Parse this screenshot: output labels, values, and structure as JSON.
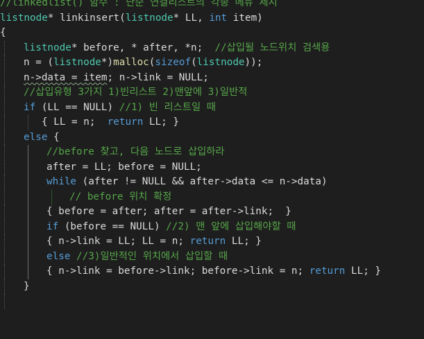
{
  "editor": {
    "theme": {
      "background": "#1e1e1e",
      "comment": "#57a64a",
      "keyword": "#569cd6",
      "function": "#dcdcaa",
      "text": "#dcdcdc"
    },
    "lines": {
      "l0": {
        "text": "//linkedlist() 함수 : 단순 연결리스트의 각종 메뉴 제시"
      },
      "l1": {
        "type": "listnode",
        "rest": "* linkinsert(",
        "ptype": "listnode",
        "rest2": "* LL, ",
        "kw": "int",
        "rest3": " item)"
      },
      "l2": {
        "text": "{"
      },
      "l3": {
        "type": "listnode",
        "rest": "* before, * after, *n;  ",
        "comment": "//삽입될 노드위치 검색용"
      },
      "l4": {
        "a": "n = (",
        "type": "listnode",
        "b": "*)",
        "fn": "malloc",
        "c": "(",
        "kw": "sizeof",
        "d": "(",
        "type2": "listnode",
        "e": "));"
      },
      "l5": {
        "squig": "n->data = item",
        "rest": "; n->link = NULL;"
      },
      "l6": {
        "comment": "//삽입유형 3가지 1)빈리스트 2)맨앞에 3)일반적"
      },
      "l7": {
        "kw": "if",
        "rest": " (LL == NULL) ",
        "comment": "//1) 빈 리스트일 때"
      },
      "l8": {
        "a": "{ LL = n;  ",
        "kw": "return",
        "b": " LL; }"
      },
      "l9": {
        "kw": "else",
        "rest": " {"
      },
      "l10": {
        "comment": "//before 찾고, 다음 노드로 삽입하라"
      },
      "l11": {
        "text": "after = LL; before = NULL;"
      },
      "l12": {
        "kw": "while",
        "rest": " (after != NULL && after->data <= n->data)"
      },
      "l13": {
        "comment": "// before 위치 확정"
      },
      "l14": {
        "text": "{ before = after; after = after->link;  }"
      },
      "l15": {
        "kw": "if",
        "rest": " (before == NULL) ",
        "comment": "//2) 맨 앞에 삽입해야할 때"
      },
      "l16": {
        "a": "{ n->link = LL; LL = n; ",
        "kw": "return",
        "b": " LL; }"
      },
      "l17": {
        "kw": "else",
        "rest": " ",
        "comment": "//3)일반적인 위치에서 삽입할 때"
      },
      "l18": {
        "a": "{ n->link = before->link; before->link = n; ",
        "kw": "return",
        "b": " LL; }"
      },
      "l19": {
        "text": "}"
      }
    }
  }
}
